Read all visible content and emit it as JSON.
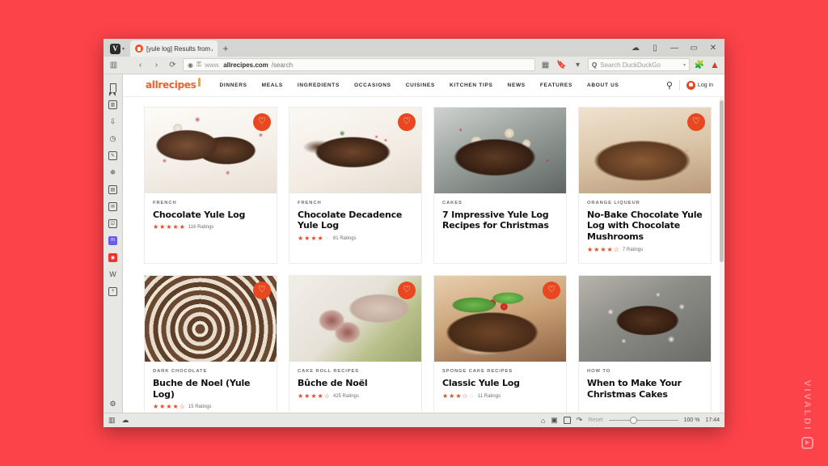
{
  "browser": {
    "name": "Vivaldi",
    "vivaldi_menu_label": "V",
    "caret": "▾",
    "tab": {
      "title": "[yule log] Results from Allr",
      "favicon_name": "allrecipes-favicon"
    },
    "newtab_label": "+",
    "window_controls": {
      "sync": "☁",
      "panel": "▯",
      "minimize": "—",
      "maximize": "▭",
      "close": "✕"
    },
    "navigation": {
      "back": "‹",
      "forward": "›",
      "reload": "⟳",
      "shield": "◉",
      "lock": "🔒"
    },
    "url": {
      "prefix": "www.",
      "domain": "allrecipes.com",
      "path": "/search"
    },
    "url_extras": {
      "grid": "▦",
      "bookmark": "🔖",
      "dropdown": "▾"
    },
    "search": {
      "placeholder": "Search DuckDuckGo",
      "engine_icon": "Q",
      "dropdown": "▾"
    },
    "toolbar_right": {
      "extensions": "🧩",
      "vivaldi_shield": "▲"
    }
  },
  "panel": {
    "items": [
      {
        "name": "bookmarks-panel",
        "glyph": "🔖"
      },
      {
        "name": "reading-list-panel",
        "glyph": "▥"
      },
      {
        "name": "downloads-panel",
        "glyph": "⇩"
      },
      {
        "name": "history-panel",
        "glyph": "◷"
      },
      {
        "name": "notes-panel",
        "glyph": "✎"
      },
      {
        "name": "translate-panel",
        "glyph": "✵"
      },
      {
        "name": "calendar-panel",
        "glyph": "▤"
      },
      {
        "name": "mail-panel",
        "glyph": "✉"
      },
      {
        "name": "tasks-panel",
        "glyph": "☑"
      },
      {
        "name": "mastodon-web-panel",
        "glyph": "m"
      },
      {
        "name": "clock-web-panel",
        "glyph": "◉"
      },
      {
        "name": "wikipedia-web-panel",
        "glyph": "W"
      },
      {
        "name": "add-web-panel",
        "glyph": "+"
      }
    ],
    "settings_glyph": "⚙"
  },
  "site": {
    "logo_text": "allrecipes",
    "nav": [
      "DINNERS",
      "MEALS",
      "INGREDIENTS",
      "OCCASIONS",
      "CUISINES",
      "KITCHEN TIPS",
      "NEWS",
      "FEATURES",
      "ABOUT US"
    ],
    "search_icon": "search-icon",
    "login_label": "Log in"
  },
  "results": [
    {
      "category": "FRENCH",
      "title": "Chocolate Yule Log",
      "rating_value": 5,
      "rating_count": "116 Ratings",
      "saved": true,
      "image_alt": "chocolate yule log on white plate with sugared cranberries"
    },
    {
      "category": "FRENCH",
      "title": "Chocolate Decadence Yule Log",
      "rating_value": 4,
      "rating_count": "81 Ratings",
      "saved": true,
      "image_alt": "chocolate yule log with holly berries on white plate"
    },
    {
      "category": "CAKES",
      "title": "7 Impressive Yule Log Recipes for Christmas",
      "rating_value": null,
      "rating_count": "",
      "saved": false,
      "image_alt": "yule log topped with meringue mushrooms"
    },
    {
      "category": "ORANGE LIQUEUR",
      "title": "No-Bake Chocolate Yule Log with Chocolate Mushrooms",
      "rating_value": 4.5,
      "rating_count": "7 Ratings",
      "saved": true,
      "image_alt": "yule log decorated with gingerbread men cookies"
    },
    {
      "category": "DARK CHOCOLATE",
      "title": "Buche de Noel (Yule Log)",
      "rating_value": 4.5,
      "rating_count": "15 Ratings",
      "saved": true,
      "image_alt": "close up of chocolate cake roll with cream filling"
    },
    {
      "category": "CAKE ROLL RECIPES",
      "title": "Bûche de Noël",
      "rating_value": 4.5,
      "rating_count": "425 Ratings",
      "saved": true,
      "image_alt": "sliced cake roll dusted with powdered sugar on platter"
    },
    {
      "category": "SPONGE CAKE RECIPES",
      "title": "Classic Yule Log",
      "rating_value": 3.5,
      "rating_count": "11 Ratings",
      "saved": true,
      "image_alt": "yule log with green marzipan leaves and red cherries"
    },
    {
      "category": "HOW TO",
      "title": "When to Make Your Christmas Cakes",
      "rating_value": null,
      "rating_count": "",
      "saved": false,
      "image_alt": "chocolate yule log with meringue mushrooms on slate board"
    }
  ],
  "status": {
    "capture_icon": "⌂",
    "image_icon": "▣",
    "tiling_icon": "▢",
    "sync_icon": "↷",
    "zoom_reset_label": "Reset",
    "zoom_percent": "100 %",
    "clock": "17:44",
    "panel_toggle": "▥",
    "cloud_icon": "☁"
  },
  "watermark": {
    "text": "VIVALDI"
  },
  "colors": {
    "desktop_background": "#fc4349",
    "accent_orange": "#e8471f",
    "logo_orange": "#f0612a",
    "star_orange": "#e8471f",
    "chrome_gray": "#e7e7e4"
  }
}
